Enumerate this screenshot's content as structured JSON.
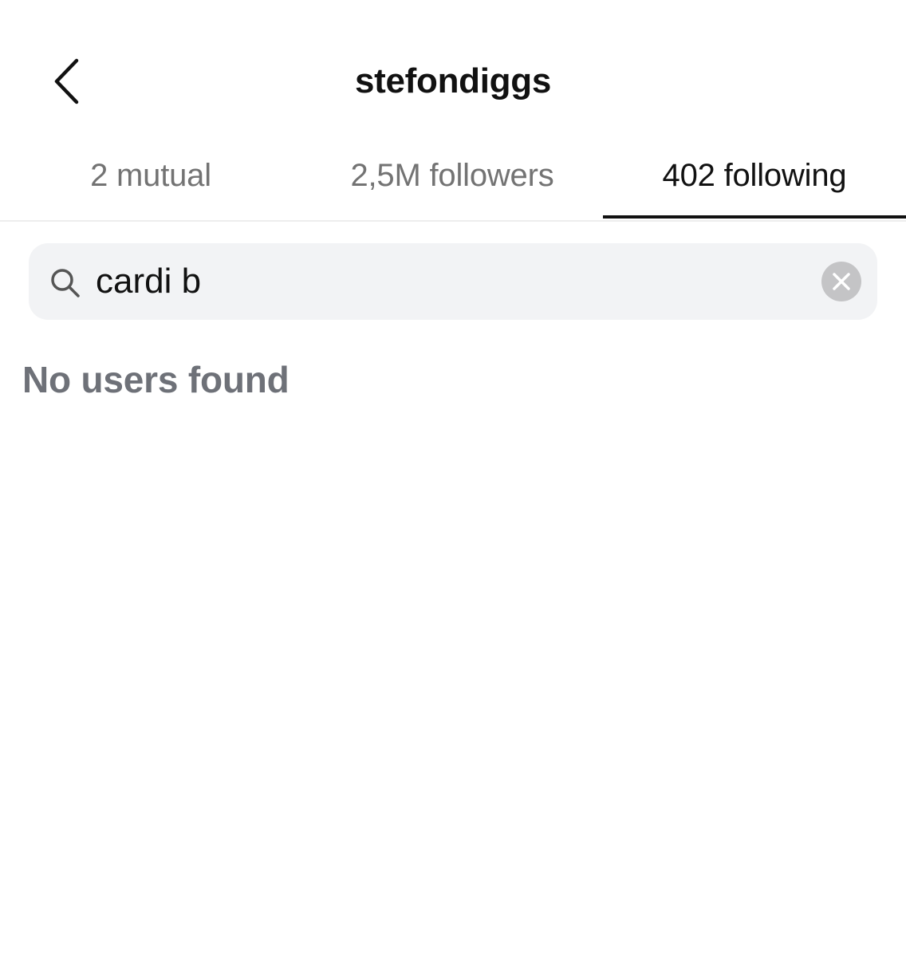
{
  "header": {
    "title": "stefondiggs",
    "back_icon": "chevron-left-icon"
  },
  "tabs": [
    {
      "label": "2 mutual",
      "active": false
    },
    {
      "label": "2,5M followers",
      "active": false
    },
    {
      "label": "402 following",
      "active": true
    }
  ],
  "search": {
    "value": "cardi b",
    "icon": "search-icon",
    "clear_icon": "clear-icon"
  },
  "results": {
    "empty_message": "No users found"
  },
  "colors": {
    "text_primary": "#111111",
    "text_secondary": "#737373",
    "search_background": "#f2f3f5",
    "clear_button": "#c4c4c6",
    "empty_message": "#6e7178"
  }
}
